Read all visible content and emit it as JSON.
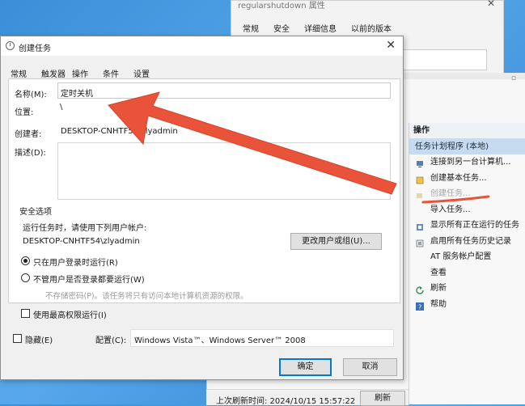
{
  "bg_properties": {
    "title": "regularshutdown 属性",
    "tabs": [
      "常规",
      "安全",
      "详细信息",
      "以前的版本"
    ]
  },
  "actions_panel": {
    "header": "操作",
    "subheader": "任务计划程序 (本地)",
    "items": [
      {
        "label": "连接到另一台计算机...",
        "icon": "computer-icon",
        "disabled": false
      },
      {
        "label": "创建基本任务...",
        "icon": "basic-task-icon",
        "disabled": false
      },
      {
        "label": "创建任务...",
        "icon": "create-task-icon",
        "disabled": true
      },
      {
        "label": "导入任务...",
        "icon": "",
        "disabled": false
      },
      {
        "label": "显示所有正在运行的任务",
        "icon": "running-tasks-icon",
        "disabled": false
      },
      {
        "label": "启用所有任务历史记录",
        "icon": "history-icon",
        "disabled": false
      },
      {
        "label": "AT 服务帐户配置",
        "icon": "",
        "disabled": false
      },
      {
        "label": "查看",
        "icon": "",
        "disabled": false
      },
      {
        "label": "刷新",
        "icon": "refresh-icon",
        "disabled": false
      },
      {
        "label": "帮助",
        "icon": "help-icon",
        "disabled": false
      }
    ]
  },
  "statusbar": {
    "last_refresh": "上次刷新时间: 2024/10/15 15:57:22",
    "refresh_button": "刷新"
  },
  "dialog": {
    "title": "创建任务",
    "tabs": [
      "常规",
      "触发器",
      "操作",
      "条件",
      "设置"
    ],
    "name_label": "名称(M):",
    "name_value": "定时关机",
    "location_label": "位置:",
    "location_value": "\\",
    "author_label": "创建者:",
    "author_value": "DESKTOP-CNHTF54\\zlyadmin",
    "description_label": "描述(D):",
    "security_header": "安全选项",
    "run_as_prompt": "运行任务时，请使用下列用户帐户:",
    "run_as_user": "DESKTOP-CNHTF54\\zlyadmin",
    "change_user_button": "更改用户或组(U)...",
    "radio_logged_on": "只在用户登录时运行(R)",
    "radio_whether_logged": "不管用户是否登录都要运行(W)",
    "no_store_password": "不存储密码(P)。该任务将只有访问本地计算机资源的权限。",
    "highest_privileges": "使用最高权限运行(I)",
    "hidden_label": "隐藏(E)",
    "configure_label": "配置(C):",
    "configure_value": "Windows Vista™、Windows Server™ 2008",
    "ok_button": "确定",
    "cancel_button": "取消"
  },
  "colors": {
    "annotation_red": "#e8533a",
    "selection_blue": "#c6dbef",
    "desktop_blue": "#3a8fd8"
  }
}
